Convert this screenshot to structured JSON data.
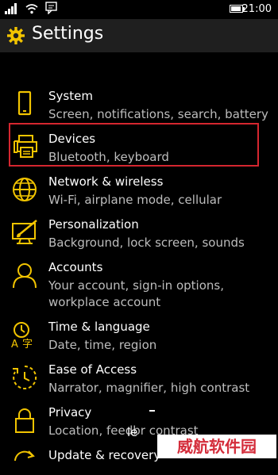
{
  "status_bar": {
    "time": "21:00",
    "icons": [
      "signal-icon",
      "wifi-icon",
      "message-icon",
      "battery-icon"
    ]
  },
  "header": {
    "title": "Settings",
    "icon": "gear-icon",
    "accent": "#f2c400"
  },
  "items": [
    {
      "name": "system",
      "title": "System",
      "subtitle": "Screen, notifications, search, battery",
      "icon": "phone-icon"
    },
    {
      "name": "devices",
      "title": "Devices",
      "subtitle": "Bluetooth, keyboard",
      "icon": "printer-icon",
      "highlighted": true
    },
    {
      "name": "network",
      "title": "Network & wireless",
      "subtitle": "Wi-Fi, airplane mode, cellular",
      "icon": "globe-icon"
    },
    {
      "name": "personalization",
      "title": "Personalization",
      "subtitle": "Background, lock screen, sounds",
      "icon": "paint-icon"
    },
    {
      "name": "accounts",
      "title": "Accounts",
      "subtitle": "Your account, sign-in options, workplace account",
      "icon": "person-icon"
    },
    {
      "name": "time-language",
      "title": "Time & language",
      "subtitle": "Date, time, region",
      "icon": "language-icon"
    },
    {
      "name": "ease-of-access",
      "title": "Ease of Access",
      "subtitle": "Narrator, magnifier, high contrast",
      "icon": "timer-icon"
    },
    {
      "name": "privacy",
      "title": "Privacy",
      "subtitle": "Location, feedbr contrast",
      "icon": "lock-icon"
    },
    {
      "name": "update-recovery",
      "title": "Update & recovery",
      "subtitle": "",
      "icon": "refresh-icon"
    }
  ],
  "highlight_color": "#d5262f",
  "watermark": "威航软件园",
  "artifact_text": "le"
}
